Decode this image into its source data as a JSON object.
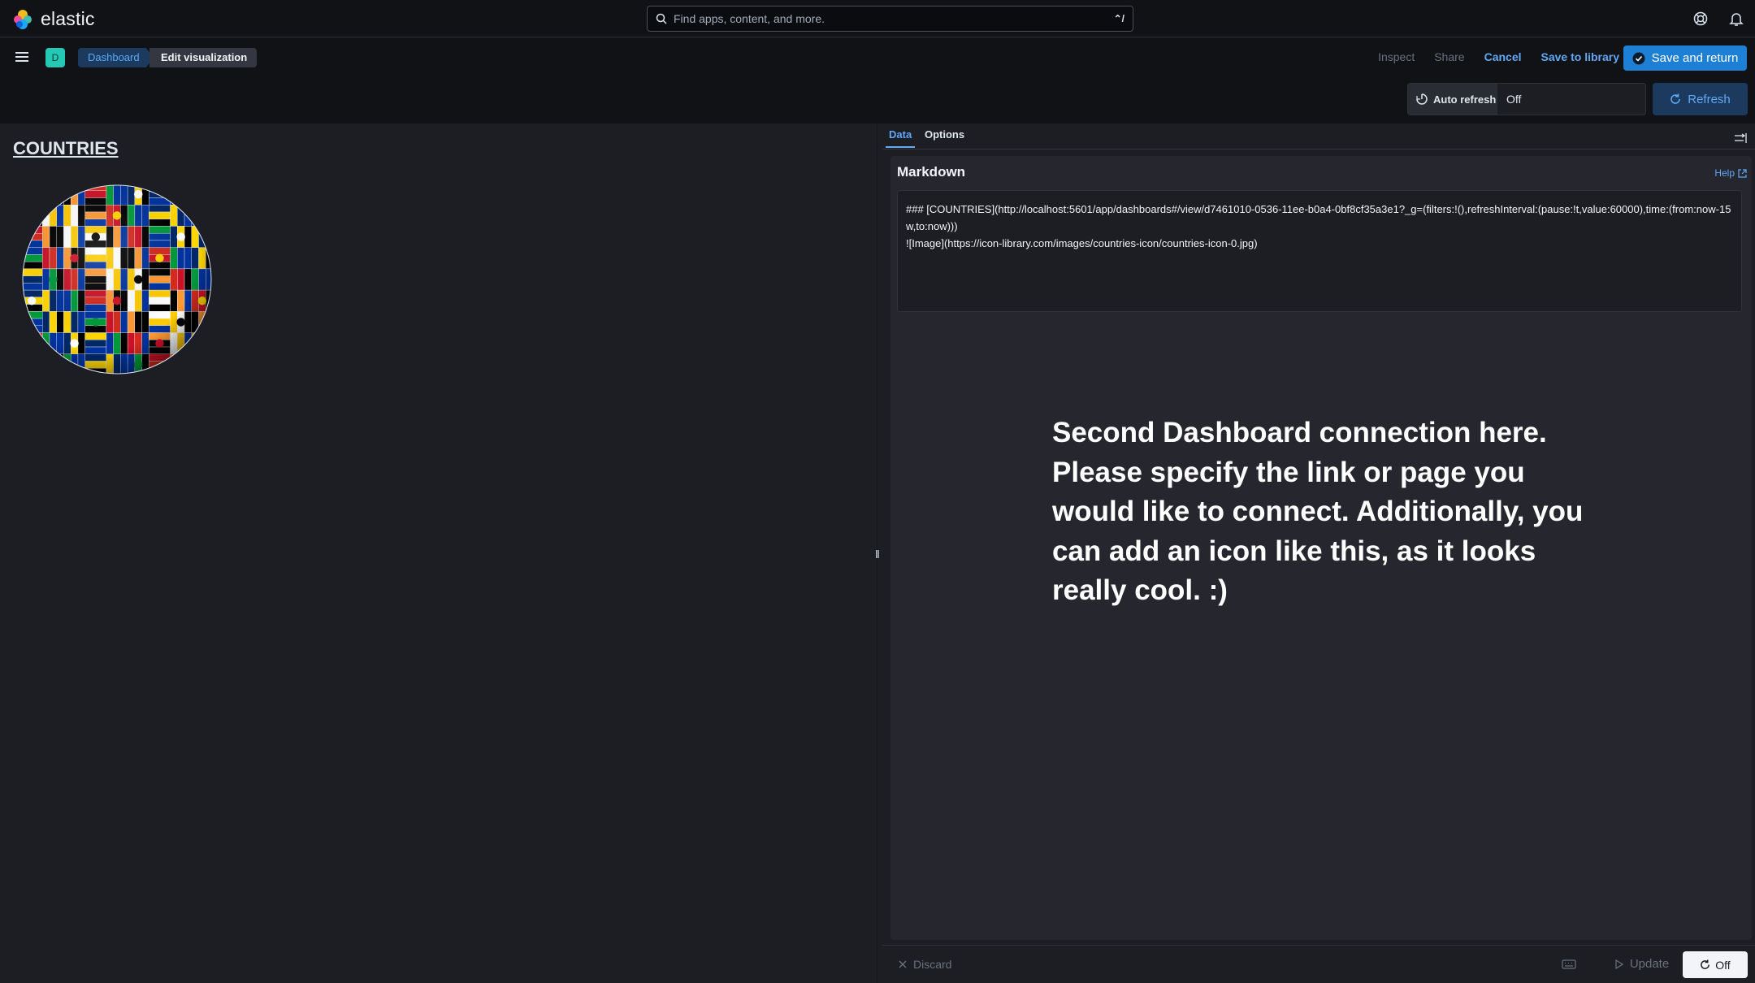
{
  "app": {
    "brand": "elastic"
  },
  "search": {
    "placeholder": "Find apps, content, and more.",
    "shortcut": "⌃/"
  },
  "breadcrumbs": {
    "space_initial": "D",
    "dashboard": "Dashboard",
    "current": "Edit visualization"
  },
  "toolbar": {
    "inspect": "Inspect",
    "share": "Share",
    "cancel": "Cancel",
    "save_to_library": "Save to library",
    "save_and_return": "Save and return"
  },
  "query_bar": {
    "auto_refresh_label": "Auto refresh",
    "auto_refresh_value": "Off",
    "refresh_label": "Refresh"
  },
  "preview": {
    "link_text": "COUNTRIES",
    "image_alt": "Image"
  },
  "editor": {
    "tabs": [
      "Data",
      "Options"
    ],
    "section_title": "Markdown",
    "help_label": "Help",
    "markdown_lines": [
      "### [COUNTRIES](http://localhost:5601/app/dashboards#/view/d7461010-0536-11ee-b0a4-0bf8cf35a3e1?_g=(filters:!(),refreshInterval:(pause:!t,value:60000),time:(from:now-15w,to:now)))",
      "![Image](https://icon-library.com/images/countries-icon/countries-icon-0.jpg)"
    ],
    "note_lines": [
      "Second Dashboard connection here.",
      "Please specify the link or page you",
      "would like to connect. Additionally, you",
      "can add an icon like this, as it looks",
      "really cool. :)"
    ]
  },
  "footer": {
    "discard": "Discard",
    "update": "Update",
    "auto_apply": "Off"
  },
  "colors": {
    "accent": "#1e80d4",
    "link": "#61a8f5",
    "background": "#1d1e24",
    "header": "#101216",
    "space_badge": "#23c9b4"
  }
}
